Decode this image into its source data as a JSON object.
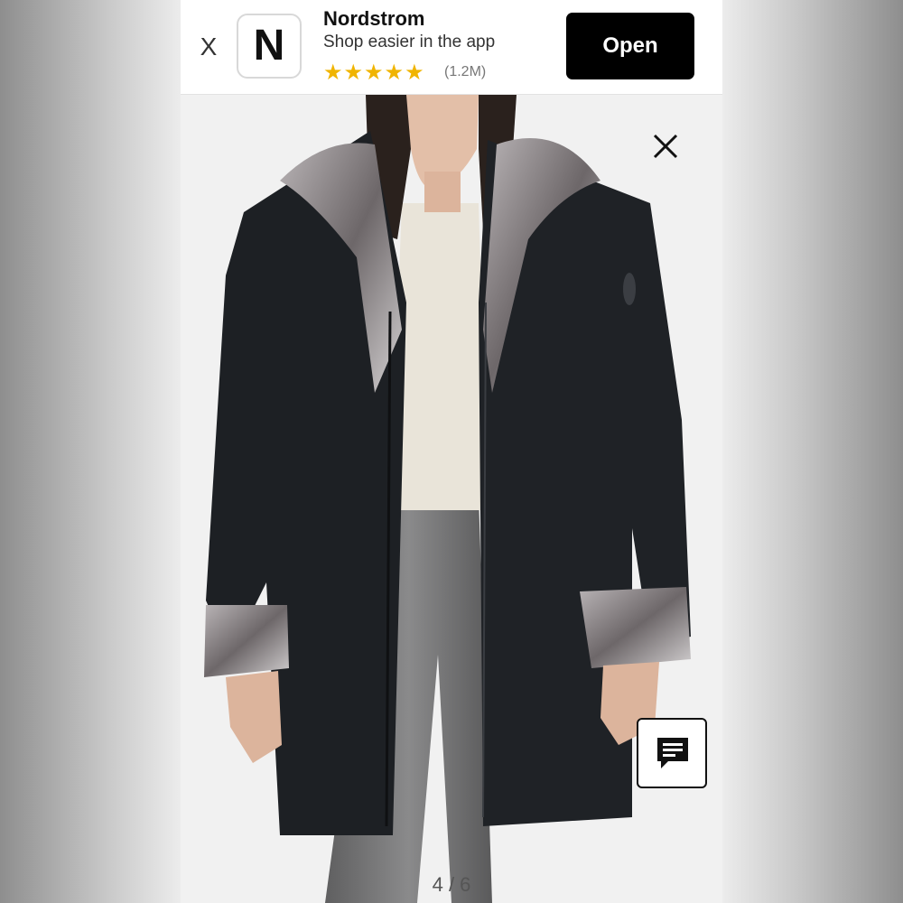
{
  "banner": {
    "close_label": "X",
    "app_icon_letter": "N",
    "app_name": "Nordstrom",
    "tagline": "Shop easier in the app",
    "stars": "★★★★★",
    "rating": 5,
    "rating_count": "(1.2M)",
    "open_label": "Open"
  },
  "gallery": {
    "current": 4,
    "total": 6,
    "counter_text": "4 / 6",
    "close_icon": "close-icon",
    "chat_icon": "chat-icon"
  },
  "colors": {
    "brand_black": "#000000",
    "star_gold": "#f0b400"
  }
}
